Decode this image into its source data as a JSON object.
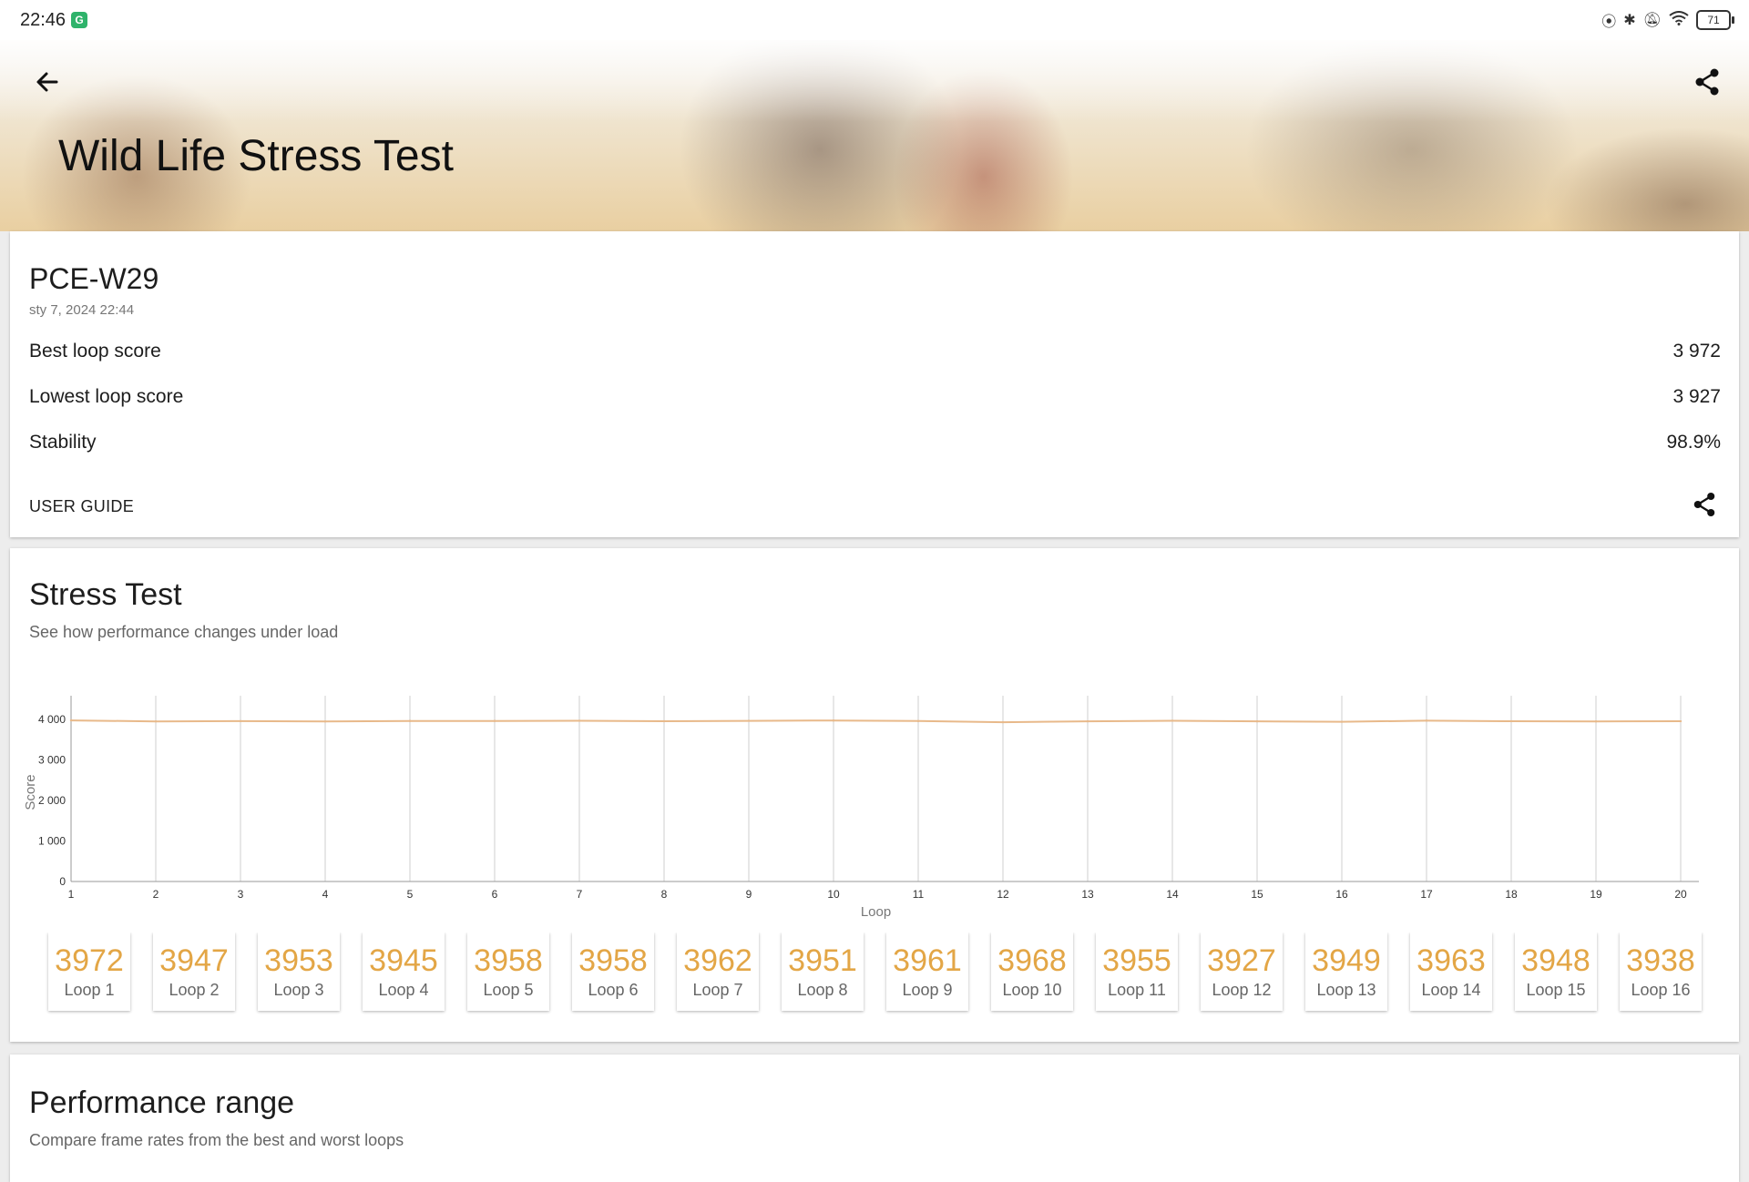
{
  "status_bar": {
    "time": "22:46",
    "app_badge": "G",
    "icons": [
      "nfc-icon",
      "bluetooth-icon",
      "mute-icon",
      "wifi-icon"
    ],
    "battery": "71"
  },
  "header": {
    "title": "Wild Life Stress Test"
  },
  "summary": {
    "device": "PCE-W29",
    "date": "sty 7, 2024 22:44",
    "rows": [
      {
        "label": "Best loop score",
        "value": "3 972"
      },
      {
        "label": "Lowest loop score",
        "value": "3 927"
      },
      {
        "label": "Stability",
        "value": "98.9%"
      }
    ],
    "user_guide": "USER GUIDE"
  },
  "stress": {
    "title": "Stress Test",
    "subtitle": "See how performance changes under load"
  },
  "chart_data": {
    "type": "line",
    "xlabel": "Loop",
    "ylabel": "Score",
    "x": [
      1,
      2,
      3,
      4,
      5,
      6,
      7,
      8,
      9,
      10,
      11,
      12,
      13,
      14,
      15,
      16,
      17,
      18,
      19,
      20
    ],
    "series": [
      {
        "values": [
          3972,
          3947,
          3953,
          3945,
          3958,
          3958,
          3962,
          3951,
          3961,
          3968,
          3955,
          3927,
          3949,
          3963,
          3948,
          3938,
          3965,
          3952,
          3946,
          3950
        ]
      }
    ],
    "ylim": [
      0,
      4400
    ],
    "yticks": [
      0,
      1000,
      2000,
      3000,
      4000
    ],
    "ytick_labels": [
      "0",
      "1 000",
      "2 000",
      "3 000",
      "4 000"
    ],
    "grid": "vertical",
    "line_color": "#e8b98a"
  },
  "loops": [
    {
      "score": "3972",
      "label": "Loop 1"
    },
    {
      "score": "3947",
      "label": "Loop 2"
    },
    {
      "score": "3953",
      "label": "Loop 3"
    },
    {
      "score": "3945",
      "label": "Loop 4"
    },
    {
      "score": "3958",
      "label": "Loop 5"
    },
    {
      "score": "3958",
      "label": "Loop 6"
    },
    {
      "score": "3962",
      "label": "Loop 7"
    },
    {
      "score": "3951",
      "label": "Loop 8"
    },
    {
      "score": "3961",
      "label": "Loop 9"
    },
    {
      "score": "3968",
      "label": "Loop 10"
    },
    {
      "score": "3955",
      "label": "Loop 11"
    },
    {
      "score": "3927",
      "label": "Loop 12"
    },
    {
      "score": "3949",
      "label": "Loop 13"
    },
    {
      "score": "3963",
      "label": "Loop 14"
    },
    {
      "score": "3948",
      "label": "Loop 15"
    },
    {
      "score": "3938",
      "label": "Loop 16"
    }
  ],
  "range": {
    "title": "Performance range",
    "subtitle": "Compare frame rates from the best and worst loops"
  },
  "colors": {
    "accent": "#e3a646",
    "line": "#e8b98a"
  }
}
